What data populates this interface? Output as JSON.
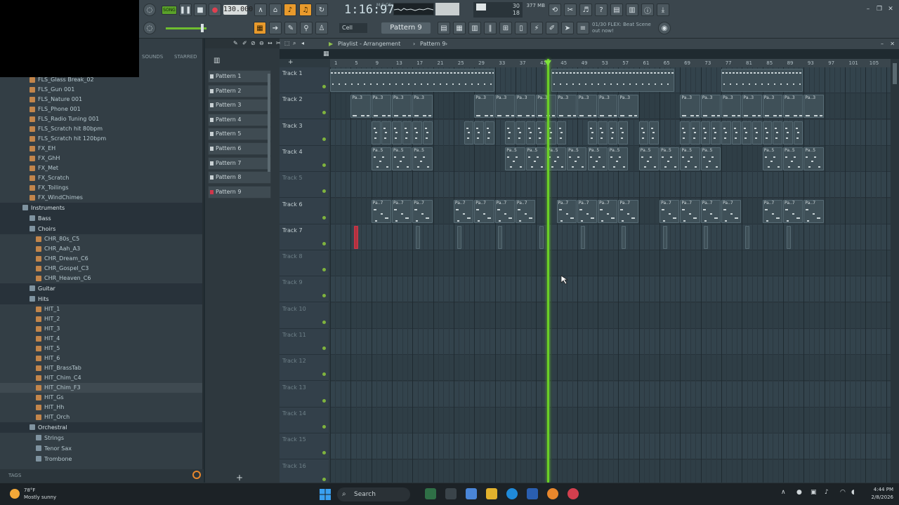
{
  "transport": {
    "song_mode": "SONG",
    "tempo": "130.000",
    "time": "1:16:97",
    "time_unit": "M:S:CS",
    "cpu_value": "30",
    "cpu_poly": "18",
    "memory": "377 MB",
    "hint_line1": "01/30  FLEX: Beat Scene",
    "hint_line2": "out now!",
    "snap": "Cell",
    "pattern": "Pattern 9"
  },
  "browser": {
    "tabs": [
      "SOUNDS",
      "STARRED"
    ],
    "items": [
      {
        "label": "FLS_Glass Break_02",
        "kind": "file",
        "indent": 2
      },
      {
        "label": "FLS_Gun 001",
        "kind": "file",
        "indent": 2
      },
      {
        "label": "FLS_Nature 001",
        "kind": "file",
        "indent": 2
      },
      {
        "label": "FLS_Phone 001",
        "kind": "file",
        "indent": 2
      },
      {
        "label": "FLS_Radio Tuning 001",
        "kind": "file",
        "indent": 2
      },
      {
        "label": "FLS_Scratch hit 80bpm",
        "kind": "file",
        "indent": 2
      },
      {
        "label": "FLS_Scratch hit 120bpm",
        "kind": "file",
        "indent": 2
      },
      {
        "label": "FX_EH",
        "kind": "file",
        "indent": 2
      },
      {
        "label": "FX_GhH",
        "kind": "file",
        "indent": 2
      },
      {
        "label": "FX_Met",
        "kind": "file",
        "indent": 2
      },
      {
        "label": "FX_Scratch",
        "kind": "file",
        "indent": 2
      },
      {
        "label": "FX_Toilings",
        "kind": "file",
        "indent": 2
      },
      {
        "label": "FX_WindChimes",
        "kind": "file",
        "indent": 2
      },
      {
        "label": "Instruments",
        "kind": "folder",
        "indent": 1
      },
      {
        "label": "Bass",
        "kind": "folder",
        "indent": 2
      },
      {
        "label": "Choirs",
        "kind": "folder",
        "indent": 2
      },
      {
        "label": "CHR_80s_C5",
        "kind": "file",
        "indent": 3
      },
      {
        "label": "CHR_Aah_A3",
        "kind": "file",
        "indent": 3
      },
      {
        "label": "CHR_Dream_C6",
        "kind": "file",
        "indent": 3
      },
      {
        "label": "CHR_Gospel_C3",
        "kind": "file",
        "indent": 3
      },
      {
        "label": "CHR_Heaven_C6",
        "kind": "file",
        "indent": 3
      },
      {
        "label": "Guitar",
        "kind": "folder",
        "indent": 2
      },
      {
        "label": "Hits",
        "kind": "folder",
        "indent": 2
      },
      {
        "label": "HIT_1",
        "kind": "file",
        "indent": 3
      },
      {
        "label": "HIT_2",
        "kind": "file",
        "indent": 3
      },
      {
        "label": "HIT_3",
        "kind": "file",
        "indent": 3
      },
      {
        "label": "HIT_4",
        "kind": "file",
        "indent": 3
      },
      {
        "label": "HIT_5",
        "kind": "file",
        "indent": 3
      },
      {
        "label": "HIT_6",
        "kind": "file",
        "indent": 3
      },
      {
        "label": "HIT_BrassTab",
        "kind": "file",
        "indent": 3
      },
      {
        "label": "HIT_Chim_C4",
        "kind": "file",
        "indent": 3
      },
      {
        "label": "HIT_Chim_F3",
        "kind": "file",
        "indent": 3,
        "highlight": true
      },
      {
        "label": "HIT_Gs",
        "kind": "file",
        "indent": 3
      },
      {
        "label": "HIT_Hh",
        "kind": "file",
        "indent": 3
      },
      {
        "label": "HIT_Orch",
        "kind": "file",
        "indent": 3
      },
      {
        "label": "Orchestral",
        "kind": "folder",
        "indent": 2
      },
      {
        "label": "Strings",
        "kind": "folder",
        "indent": 3
      },
      {
        "label": "Tenor Sax",
        "kind": "folder",
        "indent": 3
      },
      {
        "label": "Trombone",
        "kind": "folder",
        "indent": 3
      }
    ],
    "footer": "TAGS"
  },
  "patterns": [
    "Pattern 1",
    "Pattern 2",
    "Pattern 3",
    "Pattern 4",
    "Pattern 5",
    "Pattern 6",
    "Pattern 7",
    "Pattern 8",
    "Pattern 9"
  ],
  "playlist": {
    "title": "Playlist - Arrangement",
    "breadcrumb_sep": "›",
    "current_pattern": "Pattern 9",
    "bar_numbers": [
      "1",
      "5",
      "9",
      "13",
      "17",
      "21",
      "25",
      "29",
      "33",
      "37",
      "41",
      "45",
      "49",
      "53",
      "57",
      "61",
      "65",
      "69",
      "73",
      "77",
      "81",
      "85",
      "89",
      "93",
      "97",
      "101",
      "105"
    ],
    "tracks": [
      "Track 1",
      "Track 2",
      "Track 3",
      "Track 4",
      "Track 5",
      "Track 6",
      "Track 7",
      "Track 8",
      "Track 9",
      "Track 10",
      "Track 11",
      "Track 12",
      "Track 13",
      "Track 14",
      "Track 15",
      "Track 16"
    ],
    "clip_labels": {
      "track2": "Pa..3",
      "track4": "Pa..5",
      "track6": "Pa..7"
    }
  },
  "taskbar": {
    "temperature": "78°F",
    "condition": "Mostly sunny",
    "search": "Search",
    "time": "4:44 PM",
    "date": "2/8/2026"
  },
  "colors": {
    "accent_orange": "#e89a2c",
    "playhead": "#6bd026",
    "record": "#d0364a"
  }
}
